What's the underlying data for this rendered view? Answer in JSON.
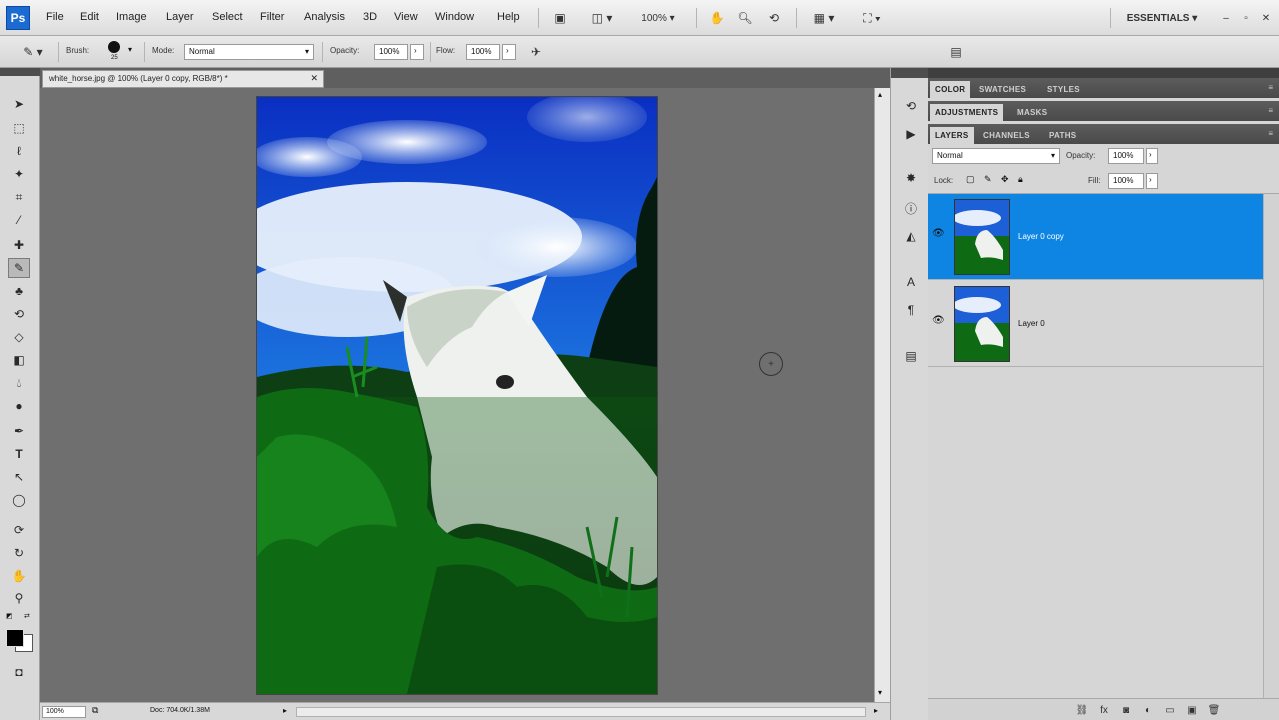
{
  "app": {
    "logo": "Ps"
  },
  "menu": [
    "File",
    "Edit",
    "Image",
    "Layer",
    "Select",
    "Filter",
    "Analysis",
    "3D",
    "View",
    "Window",
    "Help"
  ],
  "menubar_controls": {
    "zoom": "100%",
    "workspace": "ESSENTIALS"
  },
  "options": {
    "brush_label": "Brush:",
    "brush_size": "25",
    "mode_label": "Mode:",
    "mode_value": "Normal",
    "opacity_label": "Opacity:",
    "opacity_value": "100%",
    "flow_label": "Flow:",
    "flow_value": "100%"
  },
  "document": {
    "tab_title": "white_horse.jpg @ 100% (Layer 0 copy, RGB/8*) *",
    "zoom": "100%",
    "doc_size": "Doc: 704.0K/1.38M"
  },
  "panels": {
    "group1_tabs": [
      "COLOR",
      "SWATCHES",
      "STYLES"
    ],
    "group2_tabs": [
      "ADJUSTMENTS",
      "MASKS"
    ],
    "group3_tabs": [
      "LAYERS",
      "CHANNELS",
      "PATHS"
    ],
    "blend_mode": "Normal",
    "opacity_label": "Opacity:",
    "opacity_value": "100%",
    "lock_label": "Lock:",
    "fill_label": "Fill:",
    "fill_value": "100%"
  },
  "layers": [
    {
      "name": "Layer 0 copy",
      "selected": true
    },
    {
      "name": "Layer 0",
      "selected": false
    }
  ],
  "colors": {
    "selection": "#0f85e3",
    "accent": "#1b6bd0"
  }
}
